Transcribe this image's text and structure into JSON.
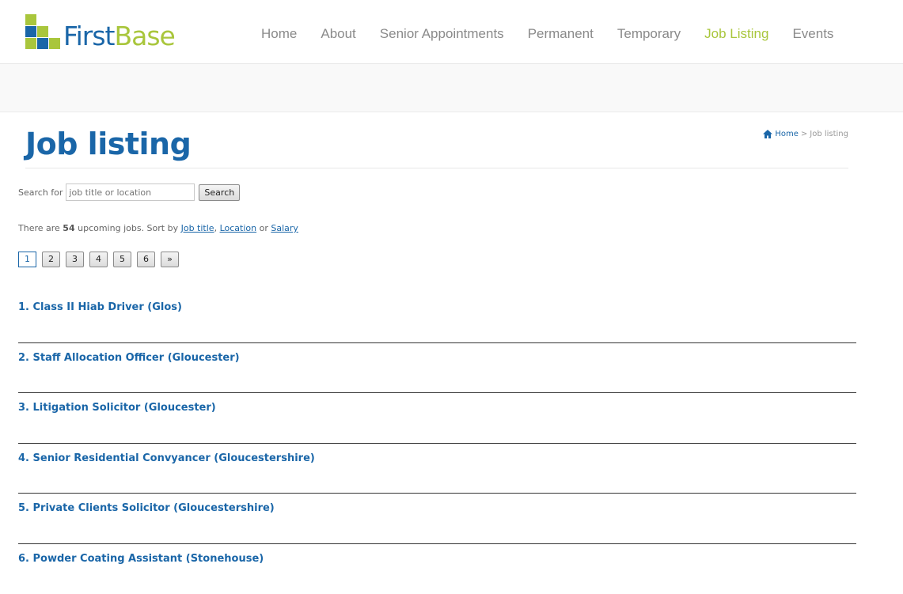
{
  "brand": {
    "name_first": "First",
    "name_second": "Base",
    "colors": {
      "blue": "#1a66a8",
      "green": "#a9c63c"
    }
  },
  "nav": {
    "items": [
      {
        "label": "Home"
      },
      {
        "label": "About"
      },
      {
        "label": "Senior Appointments"
      },
      {
        "label": "Permanent"
      },
      {
        "label": "Temporary"
      },
      {
        "label": "Job Listing",
        "active": true
      },
      {
        "label": "Events"
      }
    ]
  },
  "page": {
    "title": "Job listing"
  },
  "breadcrumb": {
    "icon": "home-icon",
    "home": "Home",
    "separator": ">",
    "current": "Job listing"
  },
  "search": {
    "label": "Search for",
    "placeholder": "job title or location",
    "button": "Search"
  },
  "summary": {
    "prefix": "There are",
    "count": "54",
    "middle": "upcoming jobs. Sort by",
    "sort_job_title": "Job title",
    "comma": ",",
    "sort_location": "Location",
    "or": "or",
    "sort_salary": "Salary"
  },
  "pagination": {
    "pages": [
      "1",
      "2",
      "3",
      "4",
      "5",
      "6"
    ],
    "current": "1",
    "next": "»"
  },
  "jobs": [
    {
      "title": "1. Class II Hiab Driver (Glos)"
    },
    {
      "title": "2. Staff Allocation Officer (Gloucester)"
    },
    {
      "title": "3. Litigation Solicitor (Gloucester)"
    },
    {
      "title": "4. Senior Residential Convyancer (Gloucestershire)"
    },
    {
      "title": "5. Private Clients Solicitor (Gloucestershire)"
    },
    {
      "title": "6. Powder Coating Assistant (Stonehouse)"
    }
  ]
}
